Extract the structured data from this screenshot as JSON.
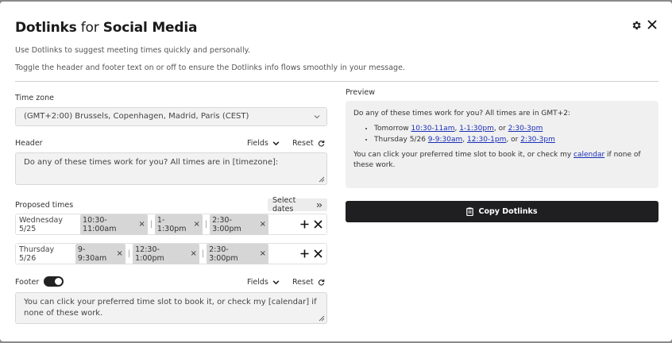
{
  "dialog": {
    "title_brand": "Dotlinks",
    "title_mid": " for ",
    "title_target": "Social Media",
    "intro_line1": "Use Dotlinks to suggest meeting times quickly and personally.",
    "intro_line2": "Toggle the header and footer text on or off to ensure the Dotlinks info flows smoothly in your message."
  },
  "timezone": {
    "label": "Time zone",
    "value": "(GMT+2:00) Brussels, Copenhagen, Madrid, Paris (CEST)"
  },
  "header": {
    "label": "Header",
    "fields_label": "Fields",
    "reset_label": "Reset",
    "text": "Do any of these times work for you? All times are in [timezone]:"
  },
  "proposed": {
    "label": "Proposed times",
    "select_dates_label": "Select dates",
    "rows": [
      {
        "day": "Wednesday 5/25",
        "slots": [
          "10:30-11:00am",
          "1-1:30pm",
          "2:30-3:00pm"
        ]
      },
      {
        "day": "Thursday 5/26",
        "slots": [
          "9-9:30am",
          "12:30-1:00pm",
          "2:30-3:00pm"
        ]
      }
    ]
  },
  "footer": {
    "label": "Footer",
    "enabled": true,
    "fields_label": "Fields",
    "reset_label": "Reset",
    "text": "You can click your preferred time slot to book it, or check my [calendar] if none of these work."
  },
  "preview": {
    "label": "Preview",
    "intro": "Do any of these times work for you? All times are in GMT+2:",
    "items": [
      {
        "day": "Tomorrow",
        "links": [
          "10:30-11am",
          "1-1:30pm",
          "2:30-3pm"
        ]
      },
      {
        "day": "Thursday 5/26",
        "links": [
          "9-9:30am",
          "12:30-1pm",
          "2:30-3pm"
        ]
      }
    ],
    "outro_before": "You can click your preferred time slot to book it, or check my ",
    "outro_link": "calendar",
    "outro_after": " if none of these work."
  },
  "copy_button": {
    "label": "Copy Dotlinks"
  },
  "colors": {
    "button_bg": "#1f1f22",
    "link": "#1a2fb8",
    "chip_bg": "#d6d6d6"
  }
}
